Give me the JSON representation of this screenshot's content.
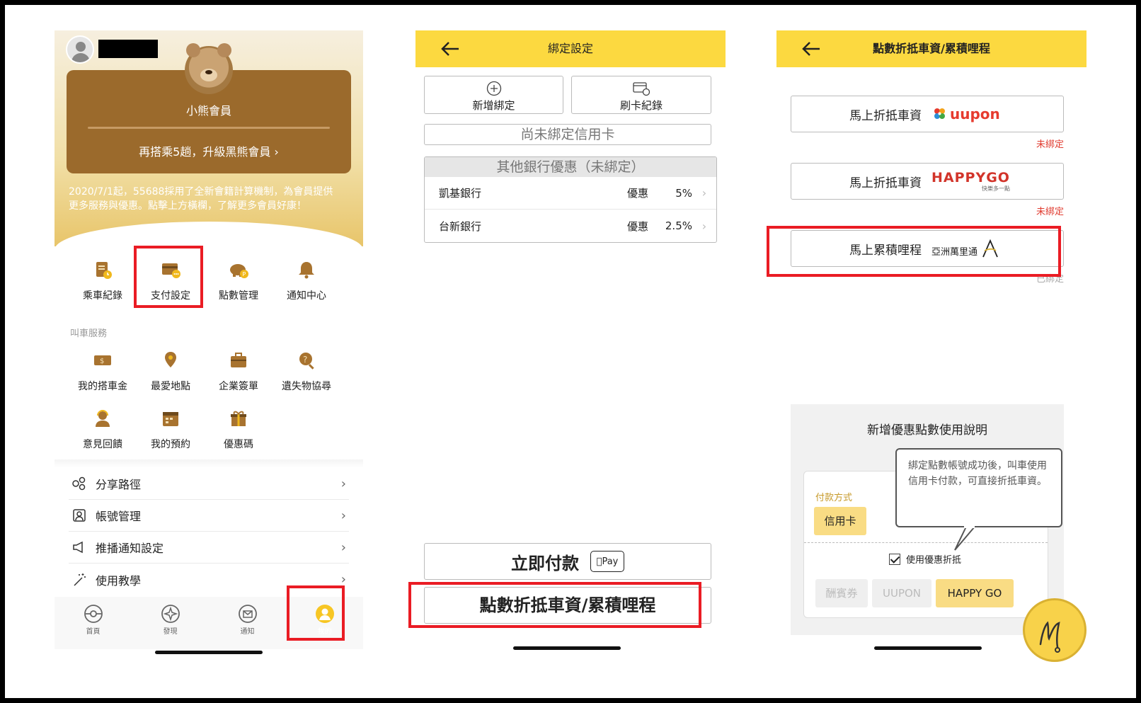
{
  "phone1": {
    "member_title": "小熊會員",
    "upgrade_text": "再搭乘5趟，升級黑熊會員 ›",
    "notice": "2020/7/1起，55688採用了全新會籍計算機制，為會員提供更多服務與優惠。點擊上方橫欄，了解更多會員好康！",
    "top_grid": [
      {
        "label": "乘車紀錄",
        "icon": "ride-record-icon"
      },
      {
        "label": "支付設定",
        "icon": "payment-card-icon"
      },
      {
        "label": "點數管理",
        "icon": "piggy-bank-icon"
      },
      {
        "label": "通知中心",
        "icon": "bell-icon"
      }
    ],
    "section_label": "叫車服務",
    "service_grid_row1": [
      {
        "label": "我的搭車金",
        "icon": "ride-money-icon"
      },
      {
        "label": "最愛地點",
        "icon": "favorite-place-icon"
      },
      {
        "label": "企業簽單",
        "icon": "enterprise-icon"
      },
      {
        "label": "遺失物協尋",
        "icon": "lost-item-icon"
      }
    ],
    "service_grid_row2": [
      {
        "label": "意見回饋",
        "icon": "feedback-icon"
      },
      {
        "label": "我的預約",
        "icon": "calendar-icon"
      },
      {
        "label": "優惠碼",
        "icon": "gift-icon"
      }
    ],
    "menu": [
      {
        "label": "分享路徑",
        "icon": "share-icon"
      },
      {
        "label": "帳號管理",
        "icon": "account-icon"
      },
      {
        "label": "推播通知設定",
        "icon": "megaphone-icon"
      },
      {
        "label": "使用教學",
        "icon": "magic-wand-icon"
      }
    ],
    "tabs": [
      {
        "label": "首頁",
        "icon": "home-icon"
      },
      {
        "label": "發現",
        "icon": "discover-icon"
      },
      {
        "label": "通知",
        "icon": "mail-icon"
      },
      {
        "label": "我的",
        "icon": "profile-icon"
      }
    ],
    "colors": {
      "brand_gold": "#9b6a2c",
      "accent_yellow": "#f7c624",
      "highlight_red": "#ea1c24"
    }
  },
  "phone2": {
    "title": "綁定設定",
    "add_binding": "新增綁定",
    "card_record": "刷卡紀錄",
    "no_card": "尚未綁定信用卡",
    "other_banks_header": "其他銀行優惠（未綁定）",
    "banks": [
      {
        "name": "凱基銀行",
        "label": "優惠",
        "value": "5%"
      },
      {
        "name": "台新銀行",
        "label": "優惠",
        "value": "2.5%"
      }
    ],
    "pay_now": "立即付款",
    "apple_pay": "Pay",
    "points_button": "點數折抵車資/累積哩程"
  },
  "phone3": {
    "title": "點數折抵車資/累積哩程",
    "items": [
      {
        "label": "馬上折抵車資",
        "logo": "uupon",
        "status": "未綁定"
      },
      {
        "label": "馬上折抵車資",
        "logo": "HAPPYGO",
        "logo_sub": "快樂多一點",
        "status": "未綁定"
      },
      {
        "label": "馬上累積哩程",
        "logo": "亞洲萬里通",
        "status": "已綁定"
      }
    ],
    "help_title": "新增優惠點數使用說明",
    "pay_method_label": "付款方式",
    "credit_card_chip": "信用卡",
    "use_discount": "使用優惠折抵",
    "chips": [
      "酬賓券",
      "UUPON",
      "HAPPY GO"
    ],
    "tooltip": "綁定點數帳號成功後，叫車使用信用卡付款，可直接折抵車資。",
    "colors": {
      "unbound": "#e03a2e",
      "bound": "#aaaaaa"
    }
  },
  "watermark": {
    "letter": "M"
  }
}
